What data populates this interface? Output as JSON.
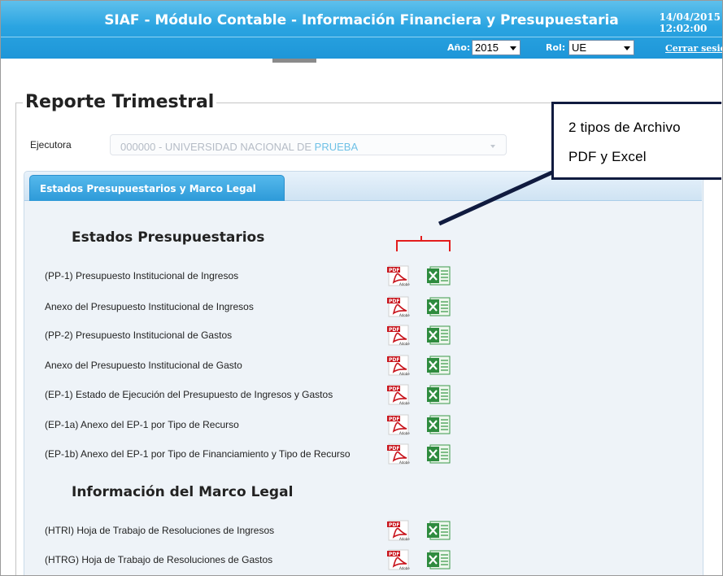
{
  "header": {
    "title": "SIAF - Módulo Contable - Información Financiera y Presupuestaria",
    "date": "14/04/2015",
    "time": "12:02:00",
    "year_label": "Año:",
    "year_value": "2015",
    "role_label": "Rol:",
    "role_value": "UE",
    "logout": "Cerrar sesión"
  },
  "page": {
    "title": "Reporte Trimestral",
    "ejecutora_label": "Ejecutora",
    "ejecutora_value": "000000 - UNIVERSIDAD NACIONAL DE",
    "ejecutora_value_highlight": "PRUEBA"
  },
  "tab": {
    "label": "Estados Presupuestarios y Marco Legal"
  },
  "sections": {
    "estados": {
      "title": "Estados Presupuestarios",
      "items": [
        "(PP-1) Presupuesto Institucional de Ingresos",
        " Anexo del Presupuesto Institucional de Ingresos",
        "(PP-2) Presupuesto Institucional de Gastos",
        " Anexo del Presupuesto Institucional de Gasto",
        "(EP-1) Estado de Ejecución del Presupuesto de Ingresos y Gastos",
        "(EP-1a) Anexo del EP-1 por Tipo de Recurso",
        "(EP-1b) Anexo del EP-1 por Tipo de Financiamiento y Tipo de Recurso"
      ]
    },
    "marco": {
      "title": "Información del Marco Legal",
      "items": [
        "(HTRI) Hoja de Trabajo de Resoluciones de Ingresos",
        "(HTRG) Hoja de Trabajo de Resoluciones de Gastos"
      ]
    }
  },
  "icons": {
    "pdf": "pdf-adobe-icon",
    "excel": "excel-icon",
    "pdf_badge": "PDF",
    "pdf_brand": "Adobe"
  },
  "callout": {
    "line1": "2 tipos de Archivo",
    "line2": "PDF y Excel"
  },
  "colors": {
    "header": "#2aa4e1",
    "tab": "#2d9ad8",
    "bracket": "#e31d1d",
    "callout_border": "#101b3f",
    "excel": "#2e8b3e",
    "pdf": "#c8141c"
  }
}
